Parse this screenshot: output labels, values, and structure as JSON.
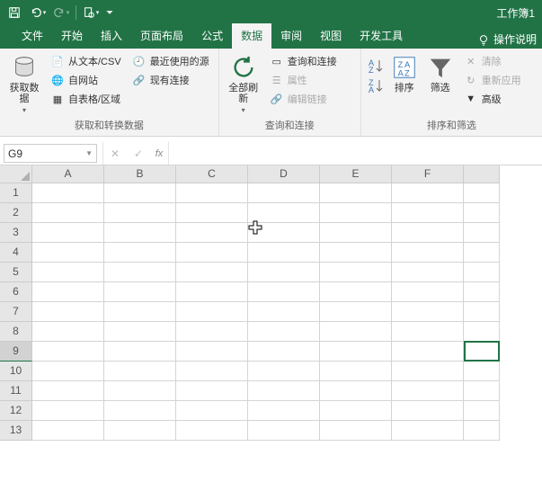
{
  "title": "工作簿1",
  "qat": {
    "save": "保存",
    "undo": "撤消",
    "redo": "重做",
    "preview": "打印预览"
  },
  "tabs": [
    "文件",
    "开始",
    "插入",
    "页面布局",
    "公式",
    "数据",
    "审阅",
    "视图",
    "开发工具"
  ],
  "active_tab": "数据",
  "help": "操作说明",
  "ribbon": {
    "g1": {
      "label": "获取和转换数据",
      "big": "获取数\n据",
      "items": [
        "从文本/CSV",
        "最近使用的源",
        "自网站",
        "现有连接",
        "自表格/区域"
      ]
    },
    "g2": {
      "label": "查询和连接",
      "big": "全部刷新",
      "items": [
        "查询和连接",
        "属性",
        "编辑链接"
      ]
    },
    "g3": {
      "label": "排序和筛选",
      "sortAsc": "升序",
      "sortDesc": "降序",
      "sort": "排序",
      "filter": "筛选",
      "clear": "清除",
      "reapply": "重新应用",
      "adv": "高级"
    }
  },
  "namebox": "G9",
  "fx": "fx",
  "cols": [
    "A",
    "B",
    "C",
    "D",
    "E",
    "F"
  ],
  "rows": [
    "1",
    "2",
    "3",
    "4",
    "5",
    "6",
    "7",
    "8",
    "9",
    "10",
    "11",
    "12",
    "13"
  ],
  "selected_row": "9"
}
